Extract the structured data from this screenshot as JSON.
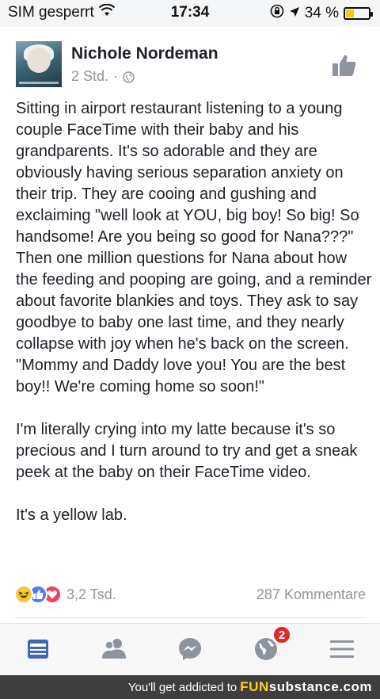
{
  "status_bar": {
    "carrier": "SIM gesperrt",
    "time": "17:34",
    "battery_percent": "34 %",
    "battery_level": 0.34,
    "battery_color": "#f6c61d"
  },
  "post": {
    "author": "Nichole Nordeman",
    "timestamp": "2 Std.",
    "separator": "·",
    "privacy_icon": "globe-icon",
    "paragraphs": [
      "Sitting in airport restaurant listening to a young couple FaceTime with their baby and his grandparents. It's so adorable and they are obviously having serious separation anxiety on their trip. They are cooing and gushing and exclaiming \"well look at YOU, big boy! So big! So handsome! Are you being so good for Nana???\" Then one million questions for Nana about how the feeding and pooping are going, and a reminder about favorite blankies and toys. They ask to say goodbye to baby one last time, and they nearly collapse with joy when he's back on the screen. \"Mommy and Daddy love you! You are the best boy!! We're coming home so soon!\"",
      "I'm literally crying into my latte because it's so precious and I turn around to try and get a sneak peek at the baby on their FaceTime video.",
      "It's a yellow lab."
    ],
    "reactions_count": "3,2 Tsd.",
    "comments_count": "287 Kommentare",
    "reaction_icons": [
      "haha-icon",
      "like-icon",
      "love-icon"
    ]
  },
  "tabbar": {
    "items": [
      "news-feed-icon",
      "friends-icon",
      "messenger-icon",
      "notifications-globe-icon",
      "menu-icon"
    ],
    "notifications_badge": "2",
    "active_color": "#4267b2",
    "inactive_color": "#8d949e"
  },
  "watermark": {
    "text": "You'll get addicted to",
    "logo_fun": "FUN",
    "logo_rest": "substance.com"
  }
}
